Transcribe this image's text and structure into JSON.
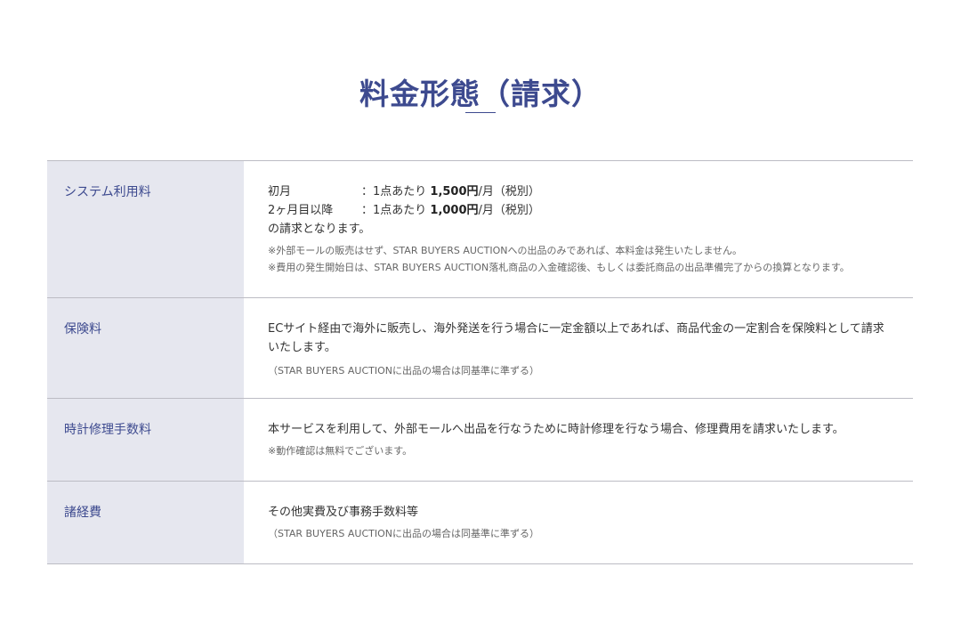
{
  "title": "料金形態（請求）",
  "rows": [
    {
      "label": "システム利用料",
      "lines": [
        {
          "label": "初月",
          "prefix": "：1点あたり ",
          "amount": "1,500円",
          "suffix": "/月（税別）"
        },
        {
          "label": "2ヶ月目以降",
          "prefix": "：1点あたり ",
          "amount": "1,000円",
          "suffix": "/月（税別）"
        }
      ],
      "text": "の請求となります。",
      "notes": [
        "※外部モールの販売はせず、STAR BUYERS AUCTIONへの出品のみであれば、本料金は発生いたしません。",
        "※費用の発生開始日は、STAR BUYERS AUCTION落札商品の入金確認後、もしくは委託商品の出品準備完了からの換算となります。"
      ]
    },
    {
      "label": "保険料",
      "text": "ECサイト経由で海外に販売し、海外発送を行う場合に一定金額以上であれば、商品代金の一定割合を保険料として請求いたします。",
      "notes": [
        "（STAR BUYERS AUCTIONに出品の場合は同基準に準ずる）"
      ]
    },
    {
      "label": "時計修理手数料",
      "text": "本サービスを利用して、外部モールへ出品を行なうために時計修理を行なう場合、修理費用を請求いたします。",
      "notes": [
        "※動作確認は無料でございます。"
      ]
    },
    {
      "label": "諸経費",
      "text": "その他実費及び事務手数料等",
      "notes": [
        "（STAR BUYERS AUCTIONに出品の場合は同基準に準ずる）"
      ]
    }
  ],
  "colors": {
    "accent": "#3d4a8f",
    "header_bg": "#e6e7ef",
    "border": "#bcbcc4",
    "text": "#333333",
    "note_text": "#666666"
  }
}
